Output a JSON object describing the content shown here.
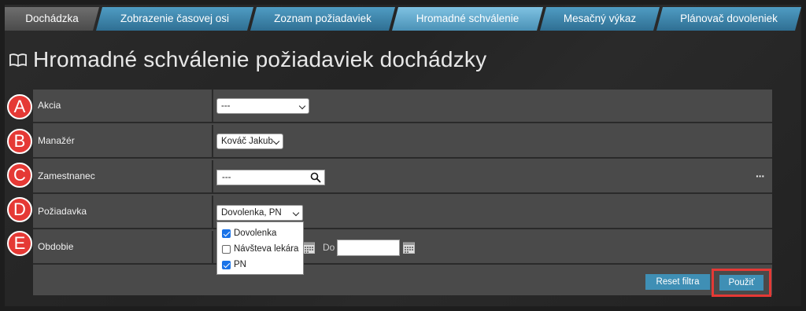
{
  "tabs": [
    {
      "label": "Dochádzka"
    },
    {
      "label": "Zobrazenie časovej osi"
    },
    {
      "label": "Zoznam požiadaviek"
    },
    {
      "label": "Hromadné schválenie"
    },
    {
      "label": "Mesačný výkaz"
    },
    {
      "label": "Plánovač dovoleniek"
    }
  ],
  "active_tab": "Hromadné schválenie",
  "page_title": "Hromadné schválenie požiadaviek dochádzky",
  "form": {
    "akcia": {
      "label": "Akcia",
      "value": "---"
    },
    "manazer": {
      "label": "Manažér",
      "value": "Kováč Jakub"
    },
    "zamestnanec": {
      "label": "Zamestnanec",
      "value": "---",
      "more": "···"
    },
    "poziadavka": {
      "label": "Požiadavka",
      "value": "Dovolenka, PN",
      "options": [
        {
          "label": "Dovolenka",
          "checked": true
        },
        {
          "label": "Návšteva lekára",
          "checked": false
        },
        {
          "label": "PN",
          "checked": true
        }
      ]
    },
    "obdobie": {
      "label": "Obdobie",
      "to_label": "Do"
    }
  },
  "buttons": {
    "reset": "Reset filtra",
    "apply": "Použiť"
  },
  "badges": [
    "A",
    "B",
    "C",
    "D",
    "E"
  ],
  "colors": {
    "accent": "#3f8fb5",
    "highlight": "#e53935",
    "panel": "#4a4a4a"
  }
}
